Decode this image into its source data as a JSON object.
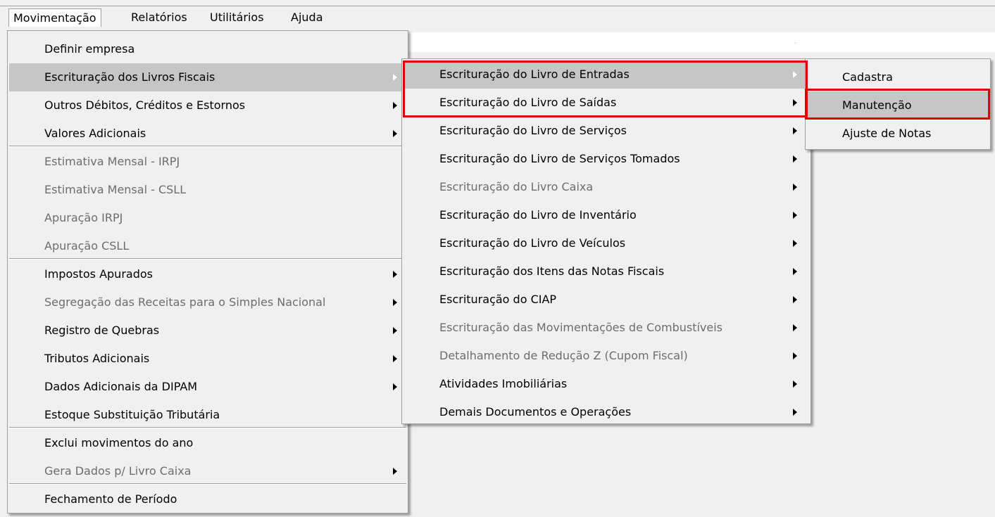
{
  "menubar": {
    "items": [
      {
        "label": "Movimentação"
      },
      {
        "label": "Relatórios"
      },
      {
        "label": "Utilitários"
      },
      {
        "label": "Ajuda"
      }
    ]
  },
  "main_menu": {
    "items": [
      {
        "label": "Definir empresa",
        "disabled": false,
        "submenu": false
      },
      {
        "label": "Escrituração dos Livros Fiscais",
        "disabled": false,
        "submenu": true,
        "selected": true
      },
      {
        "label": "Outros Débitos, Créditos e Estornos",
        "disabled": false,
        "submenu": true
      },
      {
        "label": "Valores Adicionais",
        "disabled": false,
        "submenu": true
      },
      {
        "label": "Estimativa Mensal - IRPJ",
        "disabled": true,
        "submenu": false
      },
      {
        "label": "Estimativa Mensal - CSLL",
        "disabled": true,
        "submenu": false
      },
      {
        "label": "Apuração IRPJ",
        "disabled": true,
        "submenu": false
      },
      {
        "label": "Apuração CSLL",
        "disabled": true,
        "submenu": false
      },
      {
        "label": "Impostos Apurados",
        "disabled": false,
        "submenu": true
      },
      {
        "label": "Segregação das Receitas para o Simples Nacional",
        "disabled": true,
        "submenu": true
      },
      {
        "label": "Registro de Quebras",
        "disabled": false,
        "submenu": true
      },
      {
        "label": "Tributos Adicionais",
        "disabled": false,
        "submenu": true
      },
      {
        "label": "Dados Adicionais da DIPAM",
        "disabled": false,
        "submenu": true
      },
      {
        "label": "Estoque Substituição Tributária",
        "disabled": false,
        "submenu": false
      },
      {
        "label": "Exclui movimentos do ano",
        "disabled": false,
        "submenu": false
      },
      {
        "label": "Gera Dados p/ Livro Caixa",
        "disabled": true,
        "submenu": true
      },
      {
        "label": "Fechamento de Período",
        "disabled": false,
        "submenu": false
      }
    ]
  },
  "sub_menu": {
    "items": [
      {
        "label": "Escrituração do Livro de Entradas",
        "disabled": false,
        "submenu": true,
        "selected": true
      },
      {
        "label": "Escrituração do Livro de Saídas",
        "disabled": false,
        "submenu": true
      },
      {
        "label": "Escrituração do Livro de Serviços",
        "disabled": false,
        "submenu": true
      },
      {
        "label": "Escrituração do Livro de Serviços Tomados",
        "disabled": false,
        "submenu": true
      },
      {
        "label": "Escrituração do Livro Caixa",
        "disabled": true,
        "submenu": true
      },
      {
        "label": "Escrituração do Livro de Inventário",
        "disabled": false,
        "submenu": true
      },
      {
        "label": "Escrituração do Livro de Veículos",
        "disabled": false,
        "submenu": true
      },
      {
        "label": "Escrituração dos Itens das Notas Fiscais",
        "disabled": false,
        "submenu": true
      },
      {
        "label": "Escrituração do CIAP",
        "disabled": false,
        "submenu": true
      },
      {
        "label": "Escrituração das Movimentações de Combustíveis",
        "disabled": true,
        "submenu": true
      },
      {
        "label": "Detalhamento de Redução Z (Cupom Fiscal)",
        "disabled": true,
        "submenu": true
      },
      {
        "label": "Atividades Imobiliárias",
        "disabled": false,
        "submenu": true
      },
      {
        "label": "Demais Documentos e Operações",
        "disabled": false,
        "submenu": true
      }
    ]
  },
  "sub_sub_menu": {
    "items": [
      {
        "label": "Cadastra",
        "selected": false
      },
      {
        "label": "Manutenção",
        "selected": true
      },
      {
        "label": "Ajuste de Notas",
        "selected": false
      }
    ]
  },
  "colors": {
    "highlight_box": "#e00000",
    "selected_bg": "#c6c6c6",
    "disabled_text": "#6d6d6d"
  }
}
